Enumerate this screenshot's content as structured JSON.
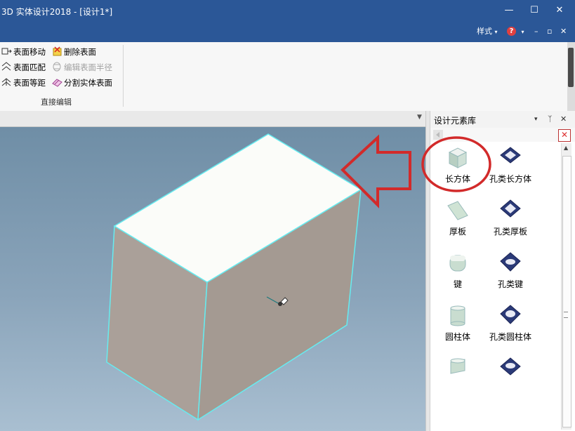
{
  "window": {
    "title": "3D 实体设计2018 - [设计1*]",
    "minimize": "—",
    "maximize": "☐",
    "close": "✕",
    "style_label": "样式",
    "help_icon": "?",
    "doc_minimize": "–",
    "doc_restore": "▫",
    "doc_close": "✕"
  },
  "ribbon": {
    "group_label": "直接编辑",
    "items": [
      {
        "label": "表面移动",
        "enabled": true
      },
      {
        "label": "删除表面",
        "enabled": true
      },
      {
        "label": "表面匹配",
        "enabled": true
      },
      {
        "label": "编辑表面半径",
        "enabled": false
      },
      {
        "label": "表面等距",
        "enabled": true
      },
      {
        "label": "分割实体表面",
        "enabled": true
      }
    ]
  },
  "panel": {
    "title": "设计元素库",
    "pin": "ᛉ",
    "dropdown": "▾",
    "close": "✕",
    "elements": [
      {
        "label": "长方体",
        "icon": "box-icon"
      },
      {
        "label": "孔类长方体",
        "icon": "box-hole-icon"
      },
      {
        "label": "厚板",
        "icon": "thick-plate-icon"
      },
      {
        "label": "孔类厚板",
        "icon": "plate-hole-icon"
      },
      {
        "label": "键",
        "icon": "key-icon"
      },
      {
        "label": "孔类键",
        "icon": "key-hole-icon"
      },
      {
        "label": "圆柱体",
        "icon": "cylinder-icon"
      },
      {
        "label": "孔类圆柱体",
        "icon": "cylinder-hole-icon"
      },
      {
        "label": "",
        "icon": "partial-cylinder-icon"
      },
      {
        "label": "",
        "icon": "partial-hole-icon"
      }
    ]
  },
  "colors": {
    "title_bar": "#2b5797",
    "highlight_red": "#d22a2a",
    "box_top": "#fbfcf9",
    "box_side": "#aaa099",
    "edge": "#66ecf0"
  }
}
